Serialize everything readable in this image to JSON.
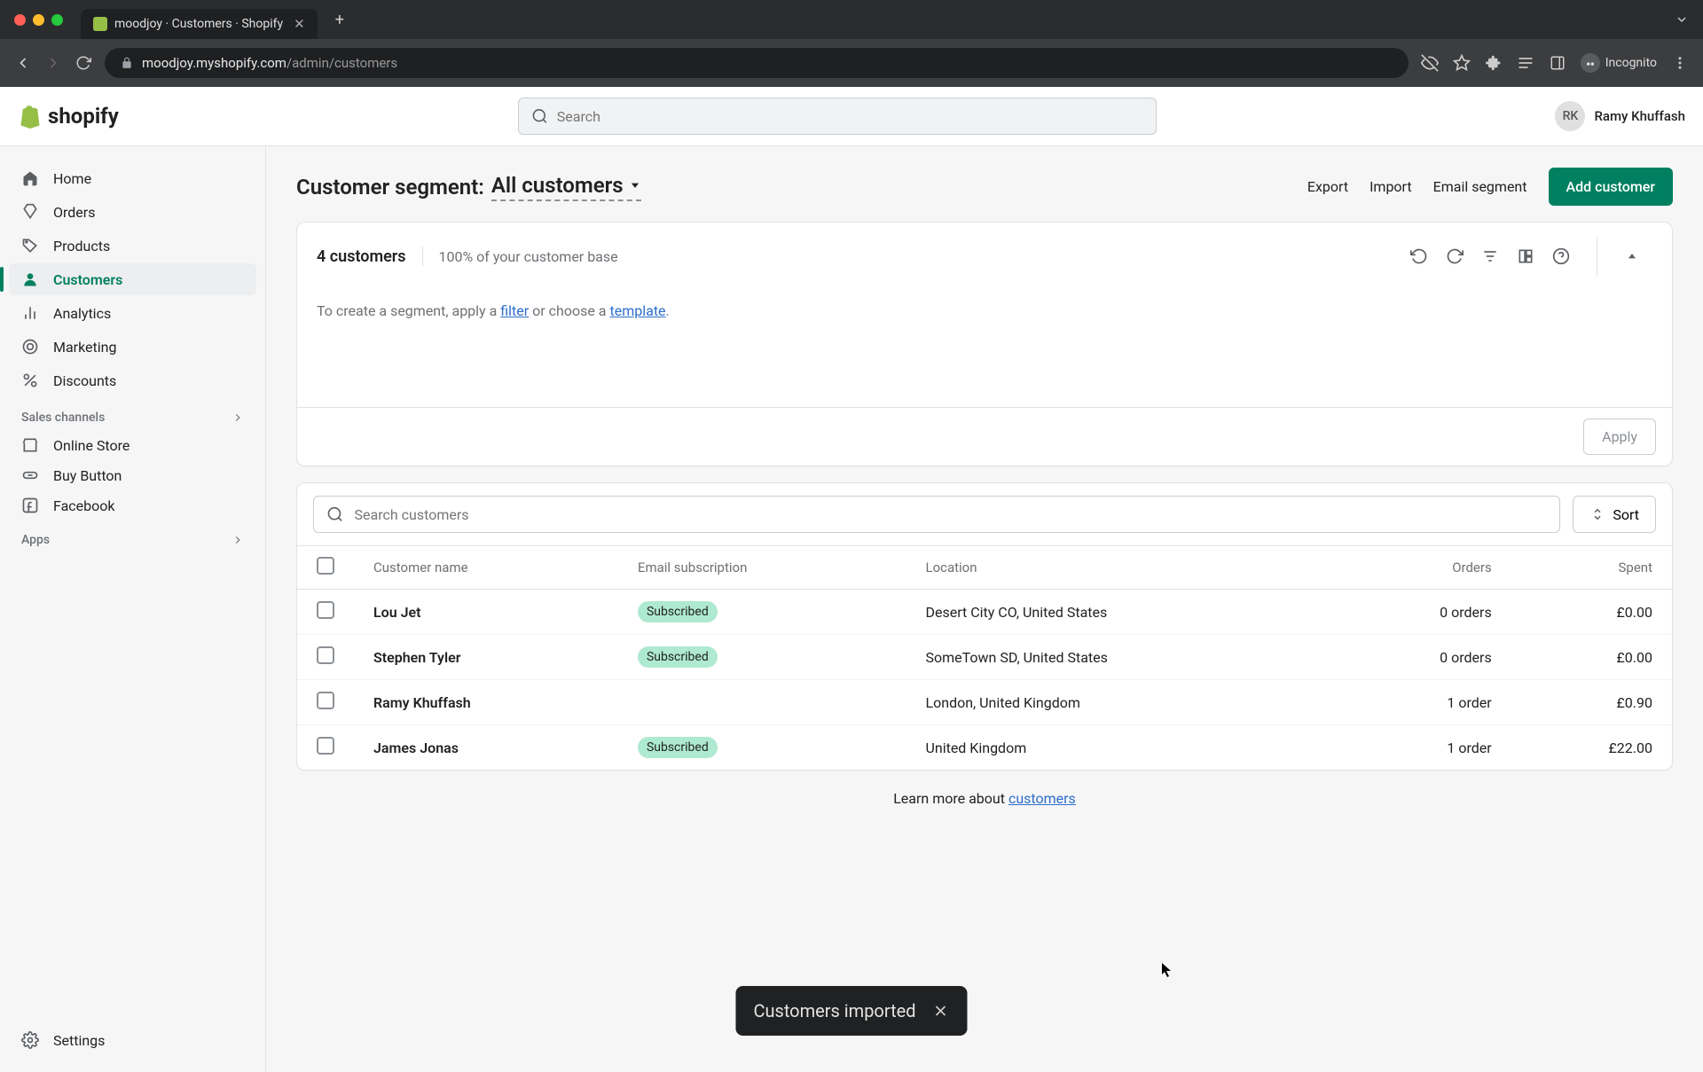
{
  "browser": {
    "tab_title": "moodjoy · Customers · Shopify",
    "url_domain": "moodjoy.myshopify.com",
    "url_path": "/admin/customers",
    "incognito_label": "Incognito"
  },
  "topbar": {
    "logo_text": "shopify",
    "search_placeholder": "Search",
    "user_initials": "RK",
    "user_name": "Ramy Khuffash"
  },
  "sidebar": {
    "items": [
      {
        "label": "Home"
      },
      {
        "label": "Orders"
      },
      {
        "label": "Products"
      },
      {
        "label": "Customers"
      },
      {
        "label": "Analytics"
      },
      {
        "label": "Marketing"
      },
      {
        "label": "Discounts"
      }
    ],
    "sales_channels_label": "Sales channels",
    "channels": [
      {
        "label": "Online Store"
      },
      {
        "label": "Buy Button"
      },
      {
        "label": "Facebook"
      }
    ],
    "apps_label": "Apps",
    "settings_label": "Settings"
  },
  "page": {
    "title": "Customer segment:",
    "segment_name": "All customers",
    "actions": {
      "export": "Export",
      "import": "Import",
      "email_segment": "Email segment",
      "add_customer": "Add customer"
    }
  },
  "segment": {
    "count_text": "4 customers",
    "base_text": "100% of your customer base",
    "help_prefix": "To create a segment, apply a ",
    "help_filter": "filter",
    "help_mid": " or choose a ",
    "help_template": "template",
    "help_suffix": ".",
    "apply_label": "Apply"
  },
  "table": {
    "search_placeholder": "Search customers",
    "sort_label": "Sort",
    "headers": {
      "name": "Customer name",
      "email": "Email subscription",
      "location": "Location",
      "orders": "Orders",
      "spent": "Spent"
    },
    "subscribed_label": "Subscribed",
    "rows": [
      {
        "name": "Lou Jet",
        "subscribed": true,
        "location": "Desert City CO, United States",
        "orders": "0 orders",
        "spent": "£0.00"
      },
      {
        "name": "Stephen Tyler",
        "subscribed": true,
        "location": "SomeTown SD, United States",
        "orders": "0 orders",
        "spent": "£0.00"
      },
      {
        "name": "Ramy Khuffash",
        "subscribed": false,
        "location": "London, United Kingdom",
        "orders": "1 order",
        "spent": "£0.90"
      },
      {
        "name": "James Jonas",
        "subscribed": true,
        "location": "United Kingdom",
        "orders": "1 order",
        "spent": "£22.00"
      }
    ]
  },
  "learn_more": {
    "prefix": "Learn more about ",
    "link": "customers"
  },
  "toast": {
    "message": "Customers imported"
  }
}
